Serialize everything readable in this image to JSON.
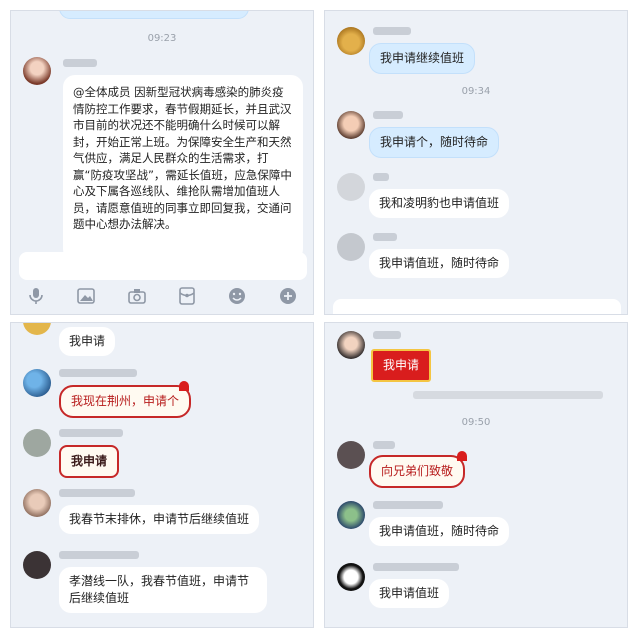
{
  "panel1": {
    "top_time": "09:23",
    "message": "@全体成员 因新型冠状病毒感染的肺炎疫情防控工作要求，春节假期延长，并且武汉市目前的状况还不能明确什么时候可以解封，开始正常上班。为保障安全生产和天然气供应，满足人民群众的生活需求，打赢“防疫攻坚战”，需延长值班，应急保障中心及下属各巡线队、维抢队需增加值班人员，请愿意值班的同事立即回复我，交通问题中心想办法解决。",
    "toolbar_icons": [
      "microphone-icon",
      "image-icon",
      "camera-icon",
      "red-packet-icon",
      "emoji-icon",
      "plus-icon"
    ]
  },
  "panel2": {
    "msg1": "我申请继续值班",
    "time": "09:34",
    "msg2": "我申请个，随时待命",
    "msg3": "我和凌明豹也申请值班",
    "msg4": "我申请值班，随时待命"
  },
  "panel3": {
    "msg1": "我申请",
    "msg2": "我现在荆州，申请个",
    "msg3": "我申请",
    "msg4": "我春节末排休，申请节后继续值班",
    "msg5_line1": "孝潜线一队，我春节值班，申请节",
    "msg5_line2": "后继续值班"
  },
  "panel4": {
    "msg1": "我申请",
    "time": "09:50",
    "msg2": "向兄弟们致敬",
    "msg3": "我申请值班，随时待命",
    "msg4": "我申请值班"
  },
  "colors": {
    "panel_bg": "#edf1f7",
    "blue_bubble": "#d6ecff",
    "festive_red": "#c62828",
    "red_packet": "#d91d1d"
  }
}
